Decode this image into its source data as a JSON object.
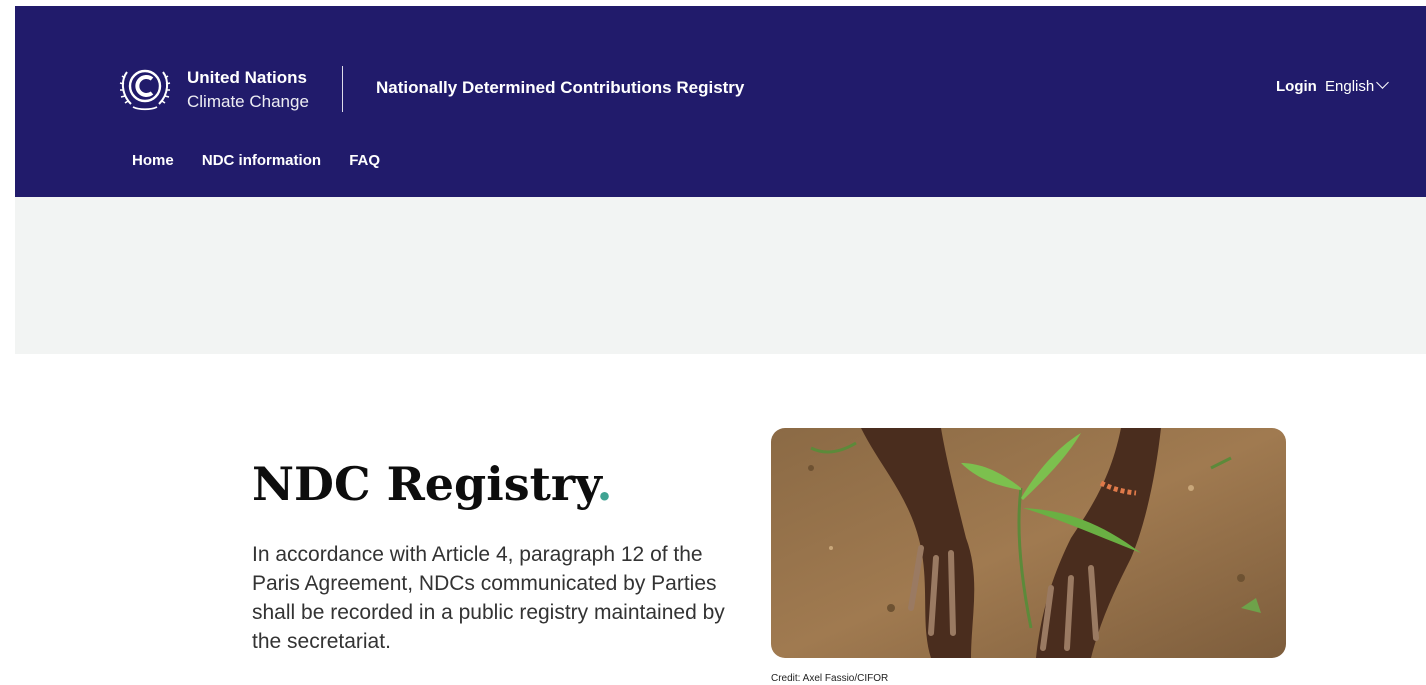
{
  "header": {
    "org_line1": "United Nations",
    "org_line2": "Climate Change",
    "registry_title": "Nationally Determined Contributions Registry",
    "login_label": "Login",
    "language_selected": "English",
    "logo_icon": "un-climate-change-emblem-icon",
    "bg_color": "#211b6b"
  },
  "nav": {
    "items": [
      {
        "label": "Home"
      },
      {
        "label": "NDC information"
      },
      {
        "label": "FAQ"
      }
    ]
  },
  "hero": {
    "title": "NDC Registry",
    "title_dot": ".",
    "accent_color": "#3fa392",
    "description": "In accordance with Article 4, paragraph 12 of the Paris Agreement, NDCs communicated by Parties shall be recorded in a public registry maintained by the secretariat.",
    "image_credit": "Credit: Axel Fassio/CIFOR"
  }
}
